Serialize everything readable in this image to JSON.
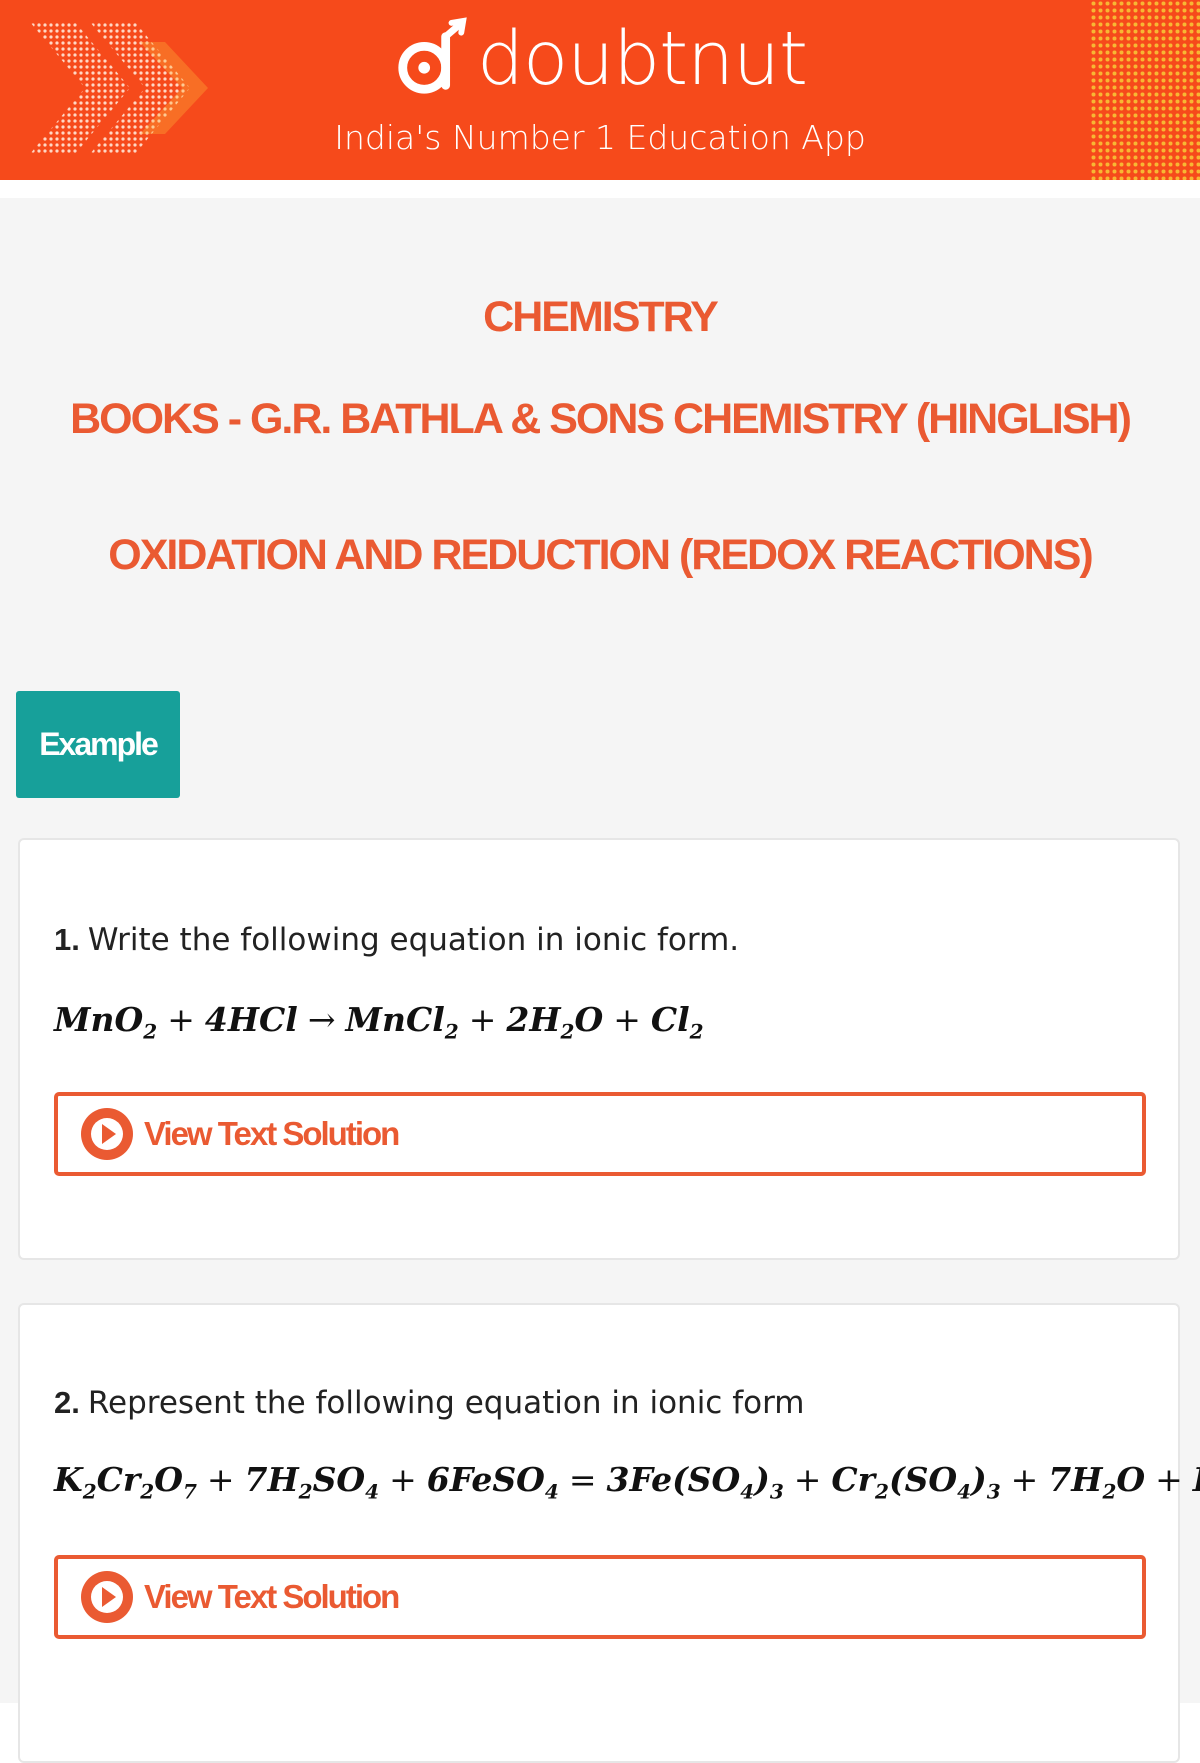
{
  "header": {
    "brand": "doubtnut",
    "tagline": "India's Number 1 Education App",
    "background_color": "#f64a1b"
  },
  "page": {
    "subject": "CHEMISTRY",
    "book": "BOOKS - G.R. BATHLA & SONS CHEMISTRY (HINGLISH)",
    "chapter": "OXIDATION AND REDUCTION (REDOX REACTIONS)",
    "section_label": "Example",
    "accent_color": "#ea5a32",
    "tag_color": "#17a09a"
  },
  "questions": [
    {
      "number": "1.",
      "text": "Write the following equation in ionic form.",
      "button_label": "View Text Solution"
    },
    {
      "number": "2.",
      "text": "Represent the following equation in ionic form",
      "button_label": "View Text Solution"
    }
  ],
  "icons": {
    "play": "play-circle-icon",
    "logo": "doubtnut-logo-icon"
  }
}
